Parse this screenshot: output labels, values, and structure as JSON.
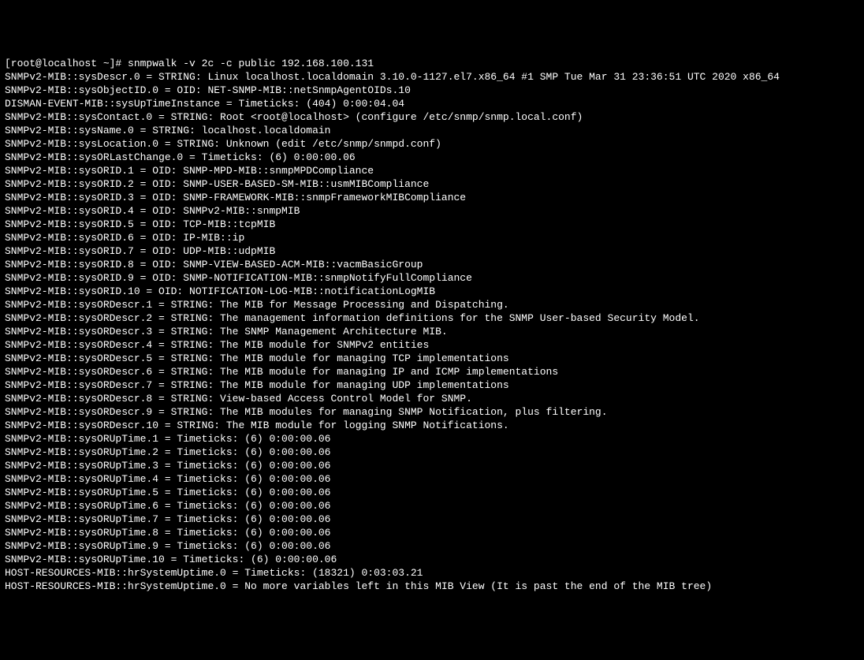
{
  "terminal": {
    "prompt": "[root@localhost ~]# ",
    "command": "snmpwalk -v 2c -c public 192.168.100.131",
    "output_lines": [
      "SNMPv2-MIB::sysDescr.0 = STRING: Linux localhost.localdomain 3.10.0-1127.el7.x86_64 #1 SMP Tue Mar 31 23:36:51 UTC 2020 x86_64",
      "SNMPv2-MIB::sysObjectID.0 = OID: NET-SNMP-MIB::netSnmpAgentOIDs.10",
      "DISMAN-EVENT-MIB::sysUpTimeInstance = Timeticks: (404) 0:00:04.04",
      "SNMPv2-MIB::sysContact.0 = STRING: Root <root@localhost> (configure /etc/snmp/snmp.local.conf)",
      "SNMPv2-MIB::sysName.0 = STRING: localhost.localdomain",
      "SNMPv2-MIB::sysLocation.0 = STRING: Unknown (edit /etc/snmp/snmpd.conf)",
      "SNMPv2-MIB::sysORLastChange.0 = Timeticks: (6) 0:00:00.06",
      "SNMPv2-MIB::sysORID.1 = OID: SNMP-MPD-MIB::snmpMPDCompliance",
      "SNMPv2-MIB::sysORID.2 = OID: SNMP-USER-BASED-SM-MIB::usmMIBCompliance",
      "SNMPv2-MIB::sysORID.3 = OID: SNMP-FRAMEWORK-MIB::snmpFrameworkMIBCompliance",
      "SNMPv2-MIB::sysORID.4 = OID: SNMPv2-MIB::snmpMIB",
      "SNMPv2-MIB::sysORID.5 = OID: TCP-MIB::tcpMIB",
      "SNMPv2-MIB::sysORID.6 = OID: IP-MIB::ip",
      "SNMPv2-MIB::sysORID.7 = OID: UDP-MIB::udpMIB",
      "SNMPv2-MIB::sysORID.8 = OID: SNMP-VIEW-BASED-ACM-MIB::vacmBasicGroup",
      "SNMPv2-MIB::sysORID.9 = OID: SNMP-NOTIFICATION-MIB::snmpNotifyFullCompliance",
      "SNMPv2-MIB::sysORID.10 = OID: NOTIFICATION-LOG-MIB::notificationLogMIB",
      "SNMPv2-MIB::sysORDescr.1 = STRING: The MIB for Message Processing and Dispatching.",
      "SNMPv2-MIB::sysORDescr.2 = STRING: The management information definitions for the SNMP User-based Security Model.",
      "SNMPv2-MIB::sysORDescr.3 = STRING: The SNMP Management Architecture MIB.",
      "SNMPv2-MIB::sysORDescr.4 = STRING: The MIB module for SNMPv2 entities",
      "SNMPv2-MIB::sysORDescr.5 = STRING: The MIB module for managing TCP implementations",
      "SNMPv2-MIB::sysORDescr.6 = STRING: The MIB module for managing IP and ICMP implementations",
      "SNMPv2-MIB::sysORDescr.7 = STRING: The MIB module for managing UDP implementations",
      "SNMPv2-MIB::sysORDescr.8 = STRING: View-based Access Control Model for SNMP.",
      "SNMPv2-MIB::sysORDescr.9 = STRING: The MIB modules for managing SNMP Notification, plus filtering.",
      "SNMPv2-MIB::sysORDescr.10 = STRING: The MIB module for logging SNMP Notifications.",
      "SNMPv2-MIB::sysORUpTime.1 = Timeticks: (6) 0:00:00.06",
      "SNMPv2-MIB::sysORUpTime.2 = Timeticks: (6) 0:00:00.06",
      "SNMPv2-MIB::sysORUpTime.3 = Timeticks: (6) 0:00:00.06",
      "SNMPv2-MIB::sysORUpTime.4 = Timeticks: (6) 0:00:00.06",
      "SNMPv2-MIB::sysORUpTime.5 = Timeticks: (6) 0:00:00.06",
      "SNMPv2-MIB::sysORUpTime.6 = Timeticks: (6) 0:00:00.06",
      "SNMPv2-MIB::sysORUpTime.7 = Timeticks: (6) 0:00:00.06",
      "SNMPv2-MIB::sysORUpTime.8 = Timeticks: (6) 0:00:00.06",
      "SNMPv2-MIB::sysORUpTime.9 = Timeticks: (6) 0:00:00.06",
      "SNMPv2-MIB::sysORUpTime.10 = Timeticks: (6) 0:00:00.06",
      "HOST-RESOURCES-MIB::hrSystemUptime.0 = Timeticks: (18321) 0:03:03.21",
      "HOST-RESOURCES-MIB::hrSystemUptime.0 = No more variables left in this MIB View (It is past the end of the MIB tree)"
    ]
  }
}
